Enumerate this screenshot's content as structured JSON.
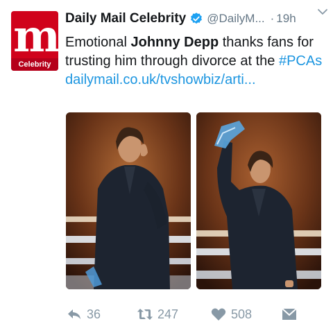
{
  "tweet": {
    "author": {
      "display_name": "Daily Mail Celebrity",
      "handle": "@DailyM...",
      "verified": true,
      "avatar_subtitle": "Celebrity"
    },
    "timestamp_separator": "·",
    "timestamp": "19h",
    "text": {
      "part1": "Emotional ",
      "highlight": "Johnny Depp",
      "part2": " thanks fans for trusting him through divorce at the ",
      "hashtag": "#PCAs",
      "link": "dailymail.co.uk/tvshowbiz/arti..."
    },
    "media": [
      {
        "icon": "photo-man-holding-ear"
      },
      {
        "icon": "photo-man-raising-trophy"
      }
    ],
    "actions": {
      "reply_count": "36",
      "retweet_count": "247",
      "like_count": "508"
    }
  },
  "colors": {
    "link": "#1b95e0",
    "brand_red": "#d0021b",
    "verified": "#1da1f2",
    "muted": "#8899a6"
  }
}
